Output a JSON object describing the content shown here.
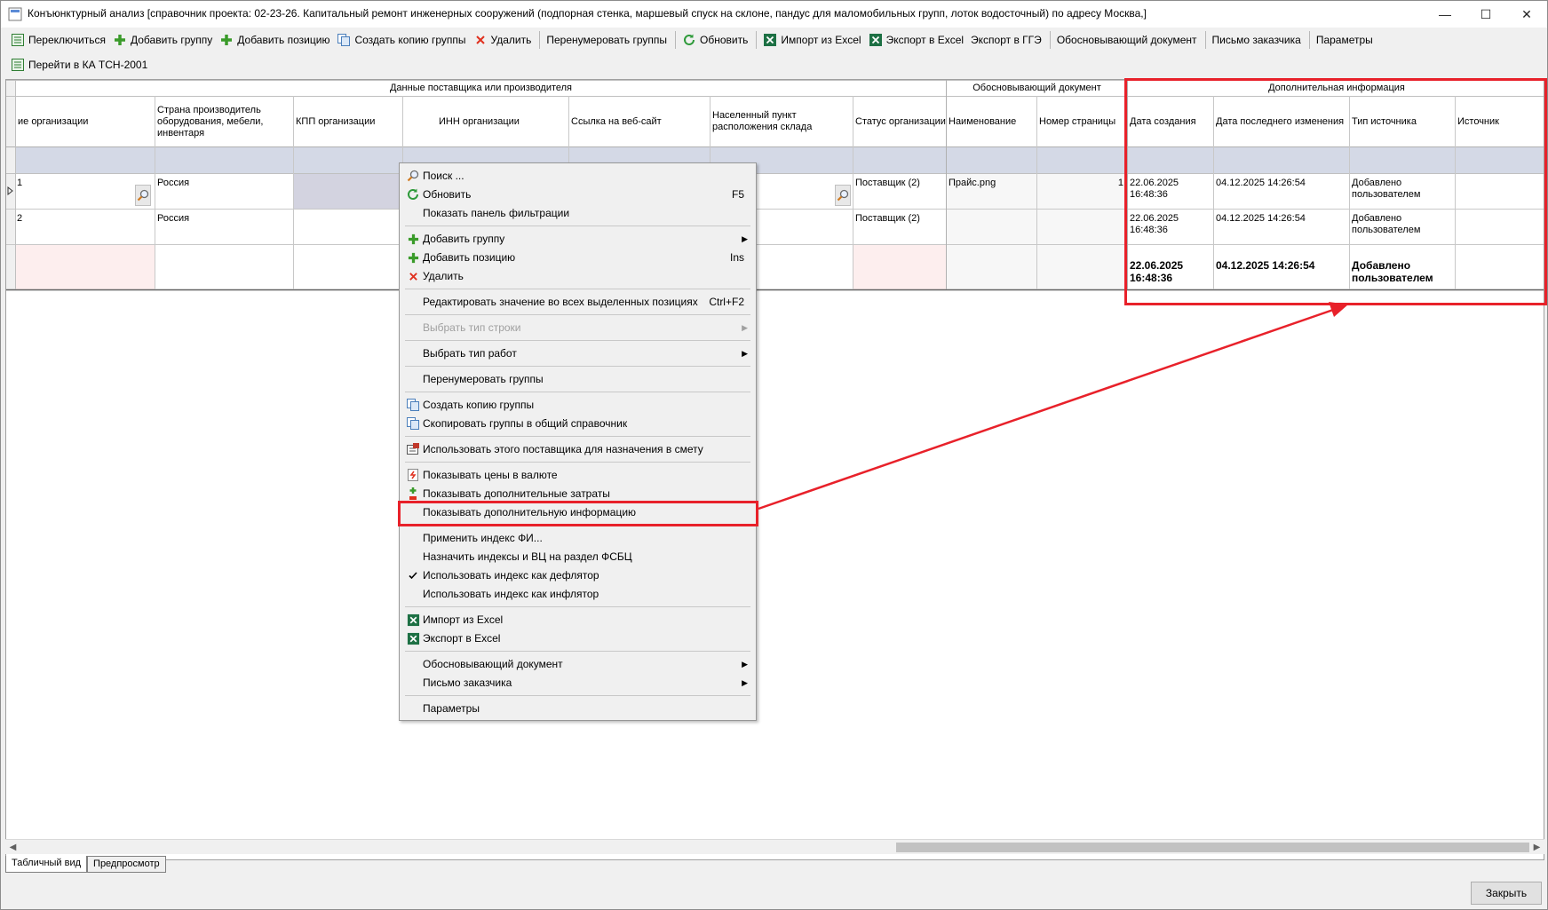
{
  "window": {
    "title": "Конъюнктурный анализ [справочник проекта: 02-23-26. Капитальный ремонт инженерных сооружений (подпорная стенка, маршевый спуск на склоне, пандус для маломобильных групп, лоток водосточный) по адресу Москва,]",
    "minimize": "—",
    "maximize": "☐",
    "close": "✕"
  },
  "toolbar": {
    "switch": "Переключиться",
    "add_group": "Добавить группу",
    "add_position": "Добавить позицию",
    "copy_group": "Создать копию группы",
    "delete": "Удалить",
    "renumber": "Перенумеровать группы",
    "refresh": "Обновить",
    "import_excel": "Импорт из Excel",
    "export_excel": "Экспорт в Excel",
    "export_gge": "Экспорт в ГГЭ",
    "justifying_doc": "Обосновывающий документ",
    "customer_letter": "Письмо заказчика",
    "params": "Параметры",
    "goto_ka": "Перейти в КА ТСН-2001"
  },
  "grid": {
    "band_supplier": "Данные поставщика или производителя",
    "band_document": "Обосновывающий документ",
    "band_extra": "Дополнительная информация",
    "columns": {
      "org_name": "ие организации",
      "country": "Страна производитель оборудования, мебели, инвентаря",
      "kpp": "КПП организации",
      "inn": "ИНН организации",
      "website": "Ссылка на веб-сайт",
      "warehouse": "Населенный пункт расположения склада",
      "org_status": "Статус организации",
      "doc_name": "Наименование",
      "page_num": "Номер страницы",
      "created": "Дата создания",
      "modified": "Дата последнего изменения",
      "source_type": "Тип источника",
      "source": "Источник"
    },
    "rows": [
      {
        "num": "1",
        "country": "Россия",
        "status": "Поставщик (2)",
        "doc": "Прайс.png",
        "page": "1",
        "created": "22.06.2025 16:48:36",
        "modified": "04.12.2025 14:26:54",
        "source_type": "Добавлено пользователем"
      },
      {
        "num": "2",
        "country": "Россия",
        "status": "Поставщик (2)",
        "doc": "",
        "page": "",
        "created": "22.06.2025 16:48:36",
        "modified": "04.12.2025 14:26:54",
        "source_type": "Добавлено пользователем"
      }
    ],
    "summary": {
      "created": "22.06.2025 16:48:36",
      "modified": "04.12.2025 14:26:54",
      "source_type": "Добавлено пользователем"
    }
  },
  "context_menu": {
    "search": "Поиск ...",
    "refresh": "Обновить",
    "refresh_sc": "F5",
    "show_filter": "Показать панель фильтрации",
    "add_group": "Добавить группу",
    "add_position": "Добавить позицию",
    "add_position_sc": "Ins",
    "delete": "Удалить",
    "edit_all": "Редактировать значение во всех выделенных позициях",
    "edit_all_sc": "Ctrl+F2",
    "row_type": "Выбрать тип строки",
    "work_type": "Выбрать тип работ",
    "renumber": "Перенумеровать группы",
    "copy_group": "Создать копию группы",
    "copy_to_common": "Скопировать группы в общий справочник",
    "use_supplier": "Использовать этого поставщика для назначения в смету",
    "show_currency": "Показывать цены в валюте",
    "show_extra_costs": "Показывать дополнительные затраты",
    "show_extra_info": "Показывать дополнительную информацию",
    "apply_index": "Применить индекс ФИ...",
    "assign_indexes": "Назначить индексы и ВЦ на раздел ФСБЦ",
    "deflator": "Использовать индекс как дефлятор",
    "inflator": "Использовать индекс как инфлятор",
    "import_excel": "Импорт из Excel",
    "export_excel": "Экспорт в Excel",
    "justifying_doc": "Обосновывающий документ",
    "customer_letter": "Письмо заказчика",
    "params": "Параметры"
  },
  "tabs": {
    "table_view": "Табличный вид",
    "preview": "Предпросмотр"
  },
  "footer": {
    "close": "Закрыть"
  },
  "colors": {
    "highlight": "#e8212a",
    "group_row": "#d4d9e6",
    "selected_cell": "#d3d3e0",
    "pink_cell": "#fdeeee"
  }
}
